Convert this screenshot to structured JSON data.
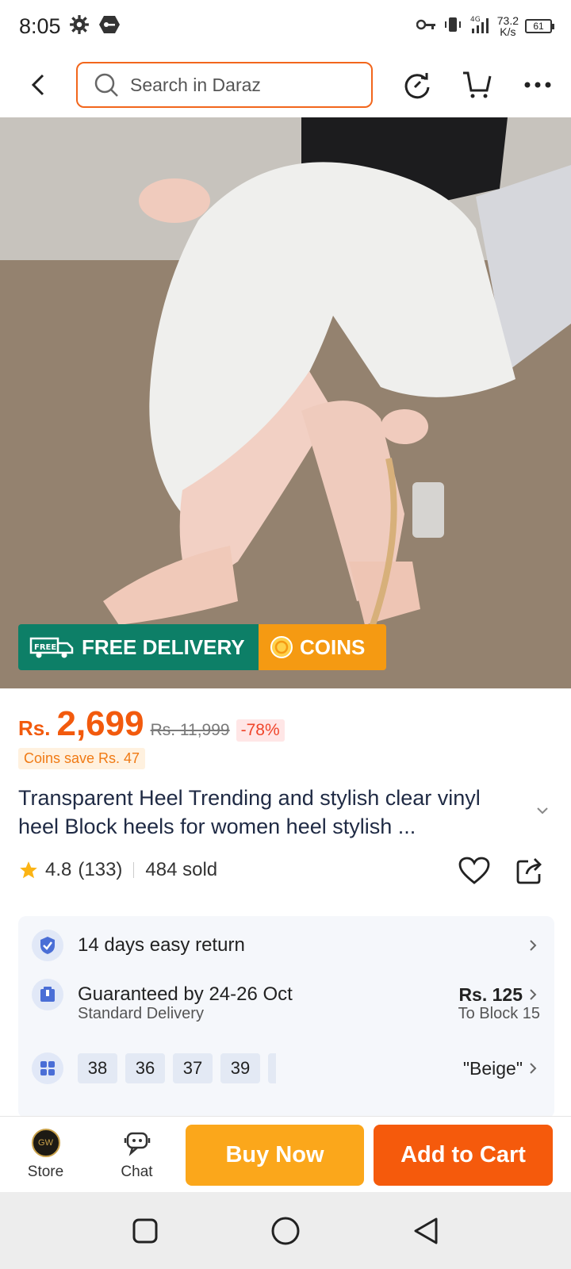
{
  "status_bar": {
    "time": "8:05",
    "network_speed": "73.2",
    "network_unit": "K/s",
    "network_type": "4G",
    "battery": "61"
  },
  "header": {
    "search_placeholder": "Search in Daraz",
    "icons": [
      "back-arrow-icon",
      "search-icon",
      "refresh-icon",
      "cart-icon",
      "more-icon"
    ]
  },
  "banner": {
    "free_badge": "FREE",
    "free_delivery": "FREE DELIVERY",
    "coins": "COINS",
    "colors": {
      "free": "#0d7f67",
      "coins": "#f59a12"
    }
  },
  "price": {
    "currency": "Rs.",
    "current": "2,699",
    "original": "Rs. 11,999",
    "discount": "-78%",
    "coins_save": "Coins save Rs. 47",
    "color": "#f25a0d"
  },
  "product": {
    "title": "Transparent Heel Trending and stylish clear vinyl heel Block heels for women heel stylish ...",
    "rating": "4.8",
    "reviews": "(133)",
    "sold": "484 sold"
  },
  "info": {
    "return": "14 days easy return",
    "delivery_title": "Guaranteed by 24-26 Oct",
    "delivery_type": "Standard Delivery",
    "delivery_price": "Rs. 125",
    "delivery_to": "To Block 15",
    "sizes": [
      "38",
      "36",
      "37",
      "39"
    ],
    "color_variant": "\"Beige\""
  },
  "action_bar": {
    "store": "Store",
    "store_logo_text": "GW",
    "chat": "Chat",
    "buy_now": "Buy Now",
    "add_to_cart": "Add to Cart",
    "colors": {
      "buy_now": "#fba71b",
      "add_to_cart": "#f55a0c"
    }
  },
  "nav_bar": {
    "icons": [
      "recent-apps-icon",
      "home-icon",
      "back-icon"
    ]
  }
}
